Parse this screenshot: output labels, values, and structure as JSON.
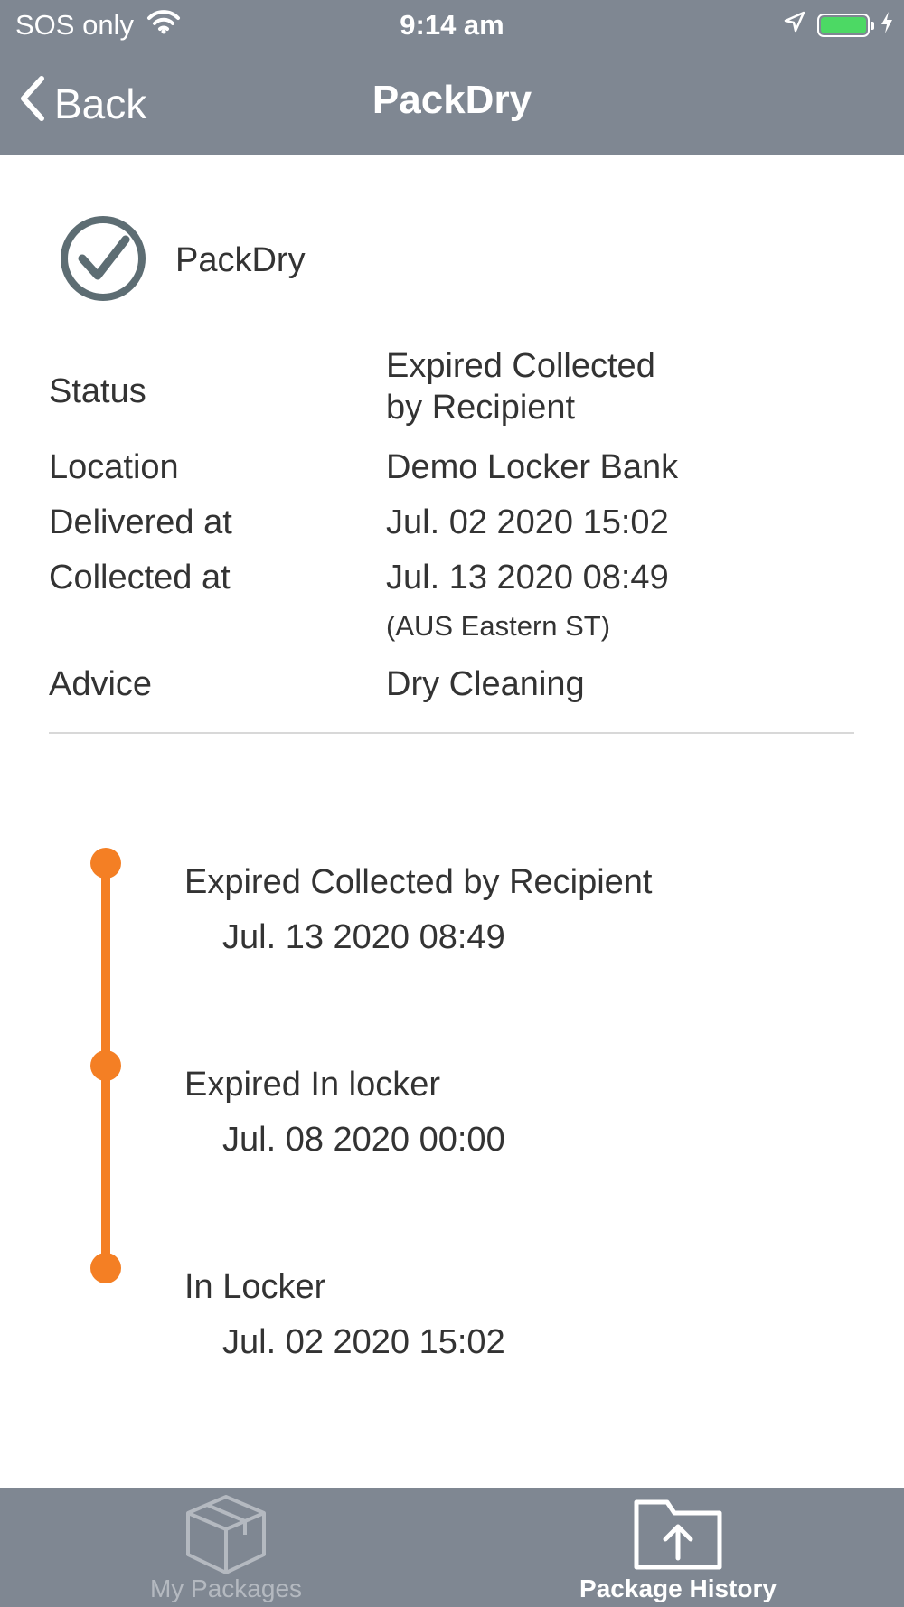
{
  "status_bar": {
    "carrier": "SOS only",
    "time": "9:14 am",
    "battery_level": 1.0,
    "battery_color": "#4cd964",
    "icons": [
      "wifi-icon",
      "location-arrow-icon",
      "battery-icon",
      "charging-bolt-icon"
    ]
  },
  "nav": {
    "back_label": "Back",
    "title": "PackDry"
  },
  "package": {
    "icon": "check-circle-icon",
    "name": "PackDry"
  },
  "details": {
    "status_label": "Status",
    "status_value_line1": "Expired Collected",
    "status_value_line2": "by Recipient",
    "location_label": "Location",
    "location_value": "Demo Locker Bank",
    "delivered_label": "Delivered at",
    "delivered_value": "Jul. 02 2020 15:02",
    "collected_label": "Collected at",
    "collected_value": "Jul. 13 2020 08:49",
    "timezone": "(AUS Eastern ST)",
    "advice_label": "Advice",
    "advice_value": "Dry Cleaning"
  },
  "timeline": {
    "accent_color": "#f47f24",
    "events": [
      {
        "title": "Expired Collected by Recipient",
        "date": "Jul. 13 2020 08:49"
      },
      {
        "title": "Expired In locker",
        "date": "Jul. 08 2020 00:00"
      },
      {
        "title": "In Locker",
        "date": "Jul. 02 2020 15:02"
      }
    ]
  },
  "tabbar": {
    "tabs": [
      {
        "label": "My Packages",
        "icon": "package-box-icon",
        "active": false
      },
      {
        "label": "Package History",
        "icon": "folder-upload-icon",
        "active": true
      }
    ]
  },
  "colors": {
    "bar_gray": "#7f8792",
    "divider": "#d8d8d8"
  }
}
